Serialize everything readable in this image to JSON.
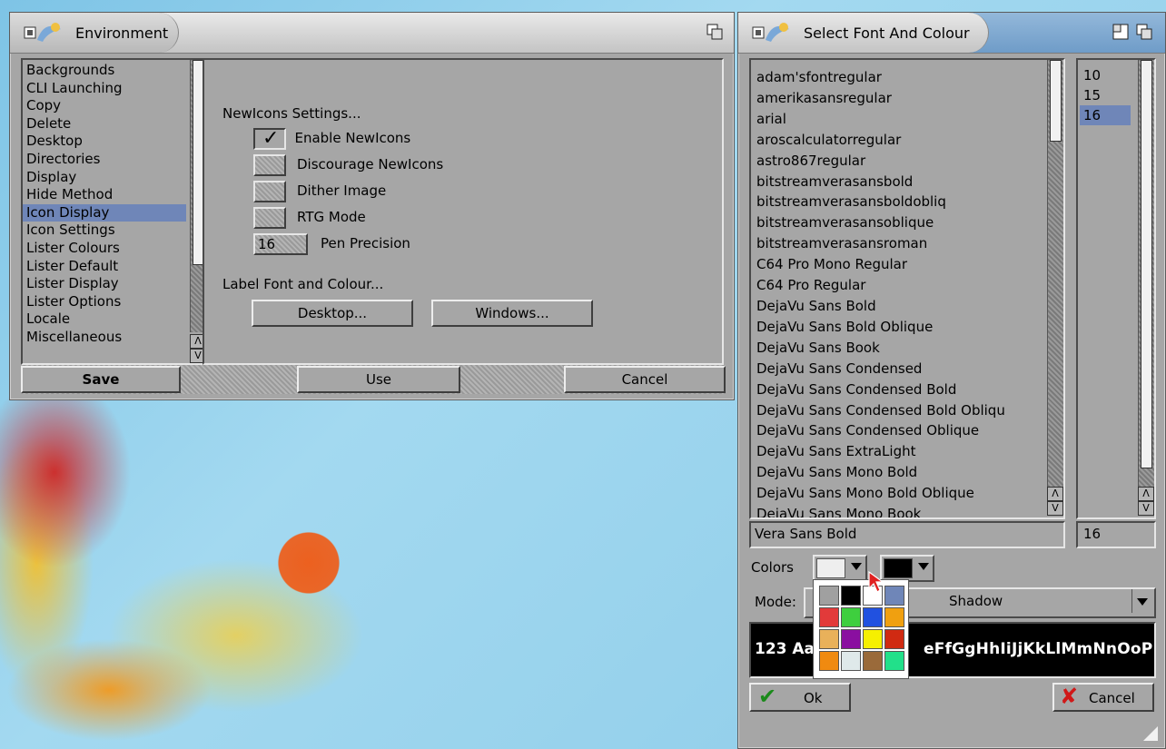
{
  "env": {
    "title": "Environment",
    "categories": [
      "Backgrounds",
      "CLI Launching",
      "Copy",
      "Delete",
      "Desktop",
      "Directories",
      "Display",
      "Hide Method",
      "Icon Display",
      "Icon Settings",
      "Lister Colours",
      "Lister Default",
      "Lister Display",
      "Lister Options",
      "Locale",
      "Miscellaneous"
    ],
    "selected": "Icon Display",
    "section1": "NewIcons Settings...",
    "options": [
      {
        "label": "Enable NewIcons",
        "checked": true
      },
      {
        "label": "Discourage NewIcons",
        "checked": false
      },
      {
        "label": "Dither Image",
        "checked": false
      },
      {
        "label": "RTG Mode",
        "checked": false
      }
    ],
    "pen_value": "16",
    "pen_label": "Pen Precision",
    "section2": "Label Font and Colour...",
    "desktop_btn": "Desktop...",
    "windows_btn": "Windows...",
    "save": "Save",
    "use": "Use",
    "cancel": "Cancel"
  },
  "font": {
    "title": "Select Font And Colour",
    "fonts": [
      "adam'sfontregular",
      "amerikasansregular",
      "arial",
      "aroscalculatorregular",
      "astro867regular",
      "bitstreamverasansbold",
      "bitstreamverasansboldobliq",
      "bitstreamverasansoblique",
      "bitstreamverasansroman",
      "C64 Pro Mono Regular",
      "C64 Pro Regular",
      "DejaVu Sans Bold",
      "DejaVu Sans Bold Oblique",
      "DejaVu Sans Book",
      "DejaVu Sans Condensed",
      "DejaVu Sans Condensed Bold",
      "DejaVu Sans Condensed Bold Obliqu",
      "DejaVu Sans Condensed Oblique",
      "DejaVu Sans ExtraLight",
      "DejaVu Sans Mono Bold",
      "DejaVu Sans Mono Bold Oblique",
      "DejaVu Sans Mono Book"
    ],
    "sizes": [
      "10",
      "15",
      "16"
    ],
    "selected_size": "16",
    "font_field": "Vera Sans Bold",
    "size_field": "16",
    "colors_label": "Colors",
    "mode_label": "Mode:",
    "mode_value": "Shadow",
    "preview_left": "123 Aa",
    "preview_right": "eFfGgHhIiJjKkLlMmNnOoP",
    "ok": "Ok",
    "cancel": "Cancel",
    "fg_color": "#eeeeee",
    "bg_color": "#000000",
    "palette": [
      "#a0a0a0",
      "#000000",
      "#ffffff",
      "#6f86b8",
      "#e23a3a",
      "#3ecf3e",
      "#2151e0",
      "#f0a010",
      "#e9b15a",
      "#8a0fa0",
      "#f6f000",
      "#d02a12",
      "#f08a10",
      "#dfe9ea",
      "#9a6a3a",
      "#22e08a"
    ]
  }
}
